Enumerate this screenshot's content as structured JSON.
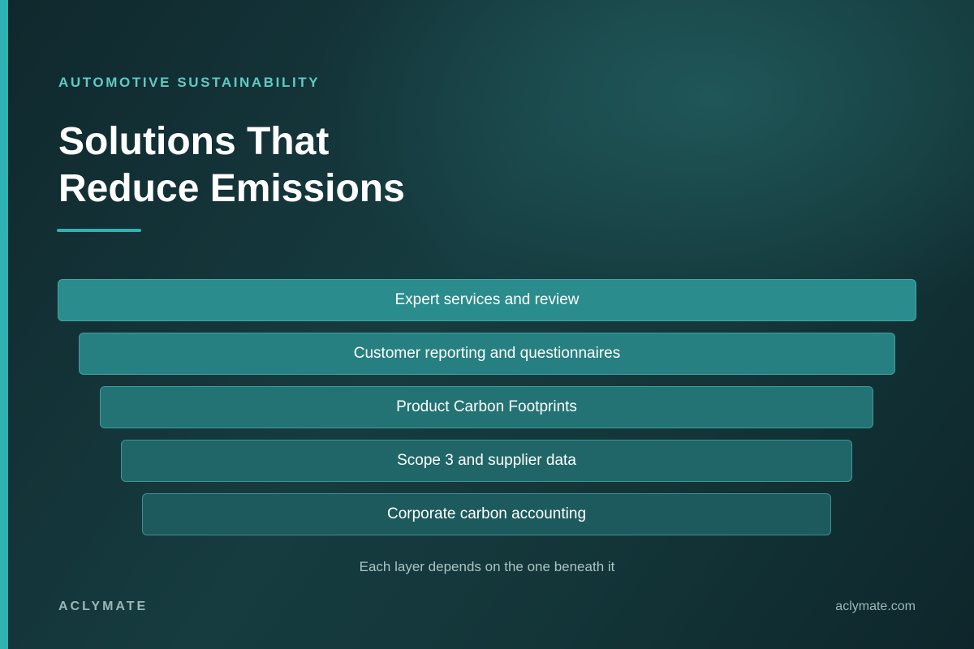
{
  "eyebrow": "AUTOMOTIVE SUSTAINABILITY",
  "title": {
    "line1": "Solutions That",
    "line2": "Reduce Emissions"
  },
  "layers": [
    {
      "label": "Expert services and review"
    },
    {
      "label": "Customer reporting and questionnaires"
    },
    {
      "label": "Product Carbon Footprints"
    },
    {
      "label": "Scope 3 and supplier data"
    },
    {
      "label": "Corporate carbon accounting"
    }
  ],
  "caption": "Each layer depends on the one beneath it",
  "footer": {
    "brand": "ACLYMATE",
    "website": "aclymate.com"
  },
  "colors": {
    "accent": "#2fb3b0",
    "eyebrow": "#5fcac4",
    "background": "#133538",
    "layer_top": "#2a8c8c",
    "layer_bottom": "#1d5a5d"
  }
}
